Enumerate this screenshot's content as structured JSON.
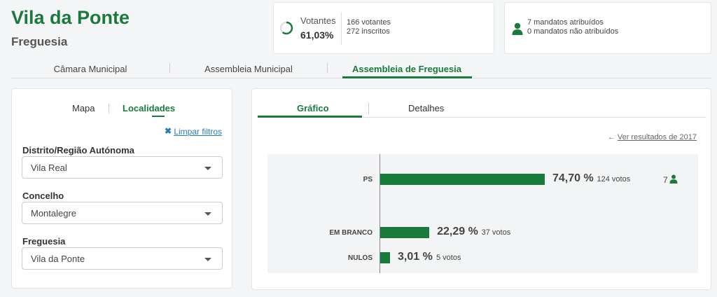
{
  "header": {
    "title": "Vila da Ponte",
    "subtitle": "Freguesia"
  },
  "votantes": {
    "label": "Votantes",
    "percent": "61,03%",
    "participation": 0.6103,
    "voters": "166 votantes",
    "registered": "272 inscritos"
  },
  "mandatos": {
    "attributed": "7 mandatos atribuídos",
    "not_attributed": "0 mandatos não atribuídos"
  },
  "main_tabs": [
    {
      "label": "Câmara Municipal"
    },
    {
      "label": "Assembleia Municipal"
    },
    {
      "label": "Assembleia de Freguesia"
    }
  ],
  "left_panel": {
    "tabs": [
      {
        "label": "Mapa"
      },
      {
        "label": "Localidades"
      }
    ],
    "clear_filters": "Limpar filtros",
    "fields": [
      {
        "label": "Distrito/Região Autónoma",
        "value": "Vila Real"
      },
      {
        "label": "Concelho",
        "value": "Montalegre"
      },
      {
        "label": "Freguesia",
        "value": "Vila da Ponte"
      }
    ]
  },
  "right_panel": {
    "tabs": [
      {
        "label": "Gráfico"
      },
      {
        "label": "Detalhes"
      }
    ],
    "prev_results": "Ver resultados de 2017"
  },
  "colors": {
    "accent": "#1a7a3c",
    "link": "#2a7ab8"
  },
  "chart_data": {
    "type": "bar",
    "orientation": "horizontal",
    "categories": [
      "PS",
      "EM BRANCO",
      "NULOS"
    ],
    "values": [
      74.7,
      22.29,
      3.01
    ],
    "labels": [
      "74,70 %",
      "22,29 %",
      "3,01 %"
    ],
    "votes": [
      "124 votos",
      "37 votos",
      "5 votos"
    ],
    "seats": [
      "7",
      "",
      ""
    ]
  }
}
